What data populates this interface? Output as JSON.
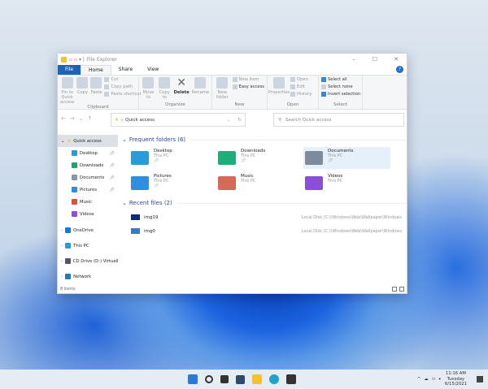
{
  "window": {
    "title": "File Explorer",
    "controls": [
      "–",
      "☐",
      "✕"
    ]
  },
  "tabs": [
    "File",
    "Home",
    "Share",
    "View"
  ],
  "ribbon": {
    "clipboard": {
      "label": "Clipboard",
      "pin": "Pin to Quick access",
      "copy": "Copy",
      "paste": "Paste",
      "cut": "Cut",
      "copy_path": "Copy path",
      "paste_shortcut": "Paste shortcut"
    },
    "organize": {
      "label": "Organize",
      "move_to": "Move to",
      "copy_to": "Copy to",
      "delete": "Delete",
      "rename": "Rename"
    },
    "new": {
      "label": "New",
      "new_folder": "New folder",
      "new_item": "New item",
      "easy_access": "Easy access"
    },
    "open": {
      "label": "Open",
      "properties": "Properties",
      "open": "Open",
      "edit": "Edit",
      "history": "History"
    },
    "select": {
      "label": "Select",
      "select_all": "Select all",
      "select_none": "Select none",
      "invert": "Invert selection"
    }
  },
  "address": {
    "path": "Quick access",
    "search_placeholder": "Search Quick access"
  },
  "nav": {
    "quick_access": "Quick access",
    "items": [
      {
        "label": "Desktop",
        "color": "#2a9ad8",
        "pinned": true
      },
      {
        "label": "Downloads",
        "color": "#22a36a",
        "pinned": true
      },
      {
        "label": "Documents",
        "color": "#8a97a8",
        "pinned": true
      },
      {
        "label": "Pictures",
        "color": "#2f8ee0",
        "pinned": true
      },
      {
        "label": "Music",
        "color": "#d9503c",
        "pinned": false
      },
      {
        "label": "Videos",
        "color": "#8a4fd8",
        "pinned": false
      }
    ],
    "roots": [
      "OneDrive",
      "This PC",
      "CD Drive (D:) VirtualB",
      "Network"
    ]
  },
  "frequent": {
    "header": "Frequent folders (6)",
    "folders": [
      {
        "name": "Desktop",
        "loc": "This PC",
        "pinned": true,
        "color": "#2a9ad8"
      },
      {
        "name": "Downloads",
        "loc": "This PC",
        "pinned": true,
        "color": "#1fae7a"
      },
      {
        "name": "Documents",
        "loc": "This PC",
        "pinned": true,
        "color": "#7d8b9c"
      },
      {
        "name": "Pictures",
        "loc": "This PC",
        "pinned": true,
        "color": "#2f8ee0"
      },
      {
        "name": "Music",
        "loc": "This PC",
        "pinned": false,
        "color": "#d46a5a"
      },
      {
        "name": "Videos",
        "loc": "This PC",
        "pinned": false,
        "color": "#8a4fd8"
      }
    ]
  },
  "recent": {
    "header": "Recent files (2)",
    "files": [
      {
        "name": "img19",
        "path": "Local Disk (C:)\\Windows\\Web\\Wallpaper\\Windows"
      },
      {
        "name": "img0",
        "path": "Local Disk (C:)\\Windows\\Web\\Wallpaper\\Windows"
      }
    ]
  },
  "status": {
    "count": "8 items"
  },
  "taskbar": {
    "time": "11:16 AM",
    "day": "Tuesday",
    "date": "6/15/2021"
  }
}
